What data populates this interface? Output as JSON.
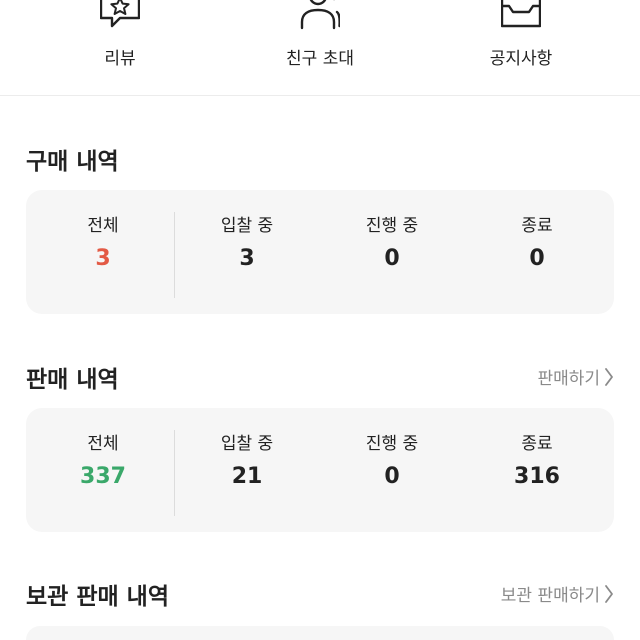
{
  "colors": {
    "accent_red": "#e35a45",
    "accent_green": "#3aa86a",
    "text": "#222222",
    "muted": "#8a8a8a",
    "card_bg": "#f6f6f6"
  },
  "shortcuts": [
    {
      "label": "리뷰",
      "icon": "review-star-icon"
    },
    {
      "label": "친구 초대",
      "icon": "friends-icon"
    },
    {
      "label": "공지사항",
      "icon": "notice-box-icon"
    }
  ],
  "purchase": {
    "title": "구매 내역",
    "stats": [
      {
        "label": "전체",
        "value": "3"
      },
      {
        "label": "입찰 중",
        "value": "3"
      },
      {
        "label": "진행 중",
        "value": "0"
      },
      {
        "label": "종료",
        "value": "0"
      }
    ]
  },
  "sales": {
    "title": "판매 내역",
    "link": "판매하기",
    "stats": [
      {
        "label": "전체",
        "value": "337"
      },
      {
        "label": "입찰 중",
        "value": "21"
      },
      {
        "label": "진행 중",
        "value": "0"
      },
      {
        "label": "종료",
        "value": "316"
      }
    ]
  },
  "storage_sales": {
    "title": "보관 판매 내역",
    "link": "보관 판매하기"
  }
}
